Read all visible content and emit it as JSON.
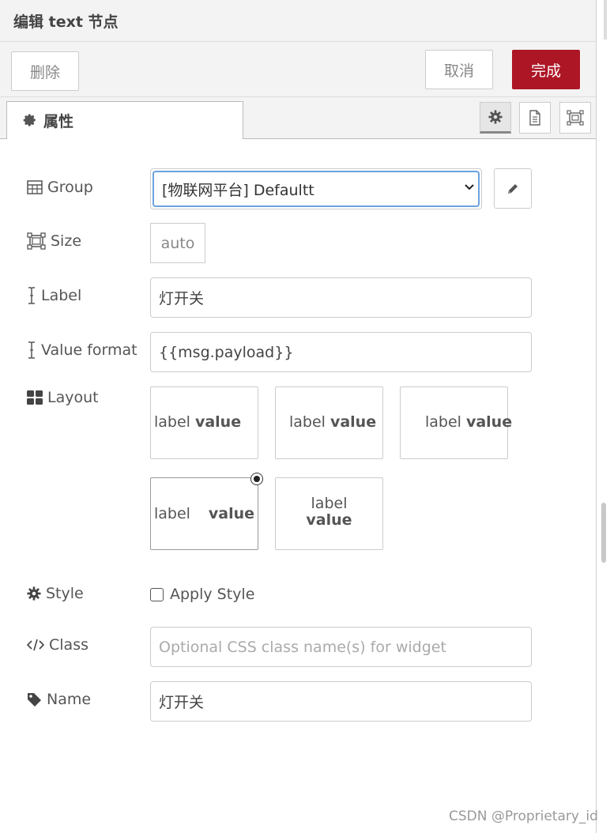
{
  "header": {
    "title": "编辑 text 节点"
  },
  "toolbar": {
    "delete_label": "删除",
    "cancel_label": "取消",
    "done_label": "完成"
  },
  "tabs": {
    "properties_label": "属性"
  },
  "form": {
    "group": {
      "label": "Group",
      "value": "[物联网平台] Defaultt"
    },
    "size": {
      "label": "Size",
      "value": "auto"
    },
    "label_field": {
      "label": "Label",
      "value": "灯开关"
    },
    "value_format": {
      "label": "Value format",
      "value": "{{msg.payload}}"
    },
    "layout": {
      "label": "Layout",
      "options": [
        {
          "label": "label",
          "value": "value"
        },
        {
          "label": "label",
          "value": "value"
        },
        {
          "label": "label",
          "value": "value"
        },
        {
          "label": "label",
          "value": "value",
          "selected": true
        },
        {
          "label": "label",
          "value": "value"
        }
      ]
    },
    "style": {
      "label": "Style",
      "checkbox_label": "Apply Style",
      "checked": false
    },
    "class": {
      "label": "Class",
      "placeholder": "Optional CSS class name(s) for widget"
    },
    "name": {
      "label": "Name",
      "value": "灯开关"
    }
  },
  "watermark": "CSDN @Proprietary_id",
  "colors": {
    "done_button": "#ad1625",
    "select_focus": "#6aa2e0"
  }
}
